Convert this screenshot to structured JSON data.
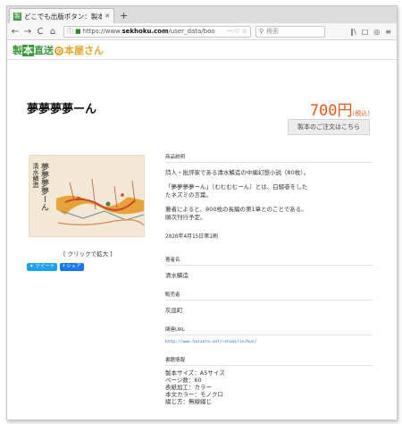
{
  "browser": {
    "tab_title": "どこでも出版ボタン：製本直",
    "tab_close": "✕",
    "new_tab": "+",
    "url_prefix": "https://www.",
    "url_host": "sekhoku.com",
    "url_path": "/user_data/boo",
    "url_more": "···",
    "search_placeholder": "検索"
  },
  "site": {
    "logo_part1": "製",
    "logo_part2": "本",
    "logo_part3": "直送",
    "logo_part4": "",
    "logo_circle": "の",
    "logo_part5": "本屋さん"
  },
  "product": {
    "title": "夢夢夢夢ーん",
    "price": "700円",
    "price_tax": "(税込)",
    "order_button": "製本のご注文はこちら",
    "cover_title": "夢夢夢夢ーん",
    "cover_author": "清水鱗造",
    "enlarge_label": "[ クリックで拡大 ]",
    "tweet_label": "ツイート",
    "share_label": "シェア"
  },
  "details": {
    "description_label": "商品説明",
    "description": [
      "詩人・批評家である清水鱗造の中編幻想小説（80枚）。",
      "「夢夢夢夢ーん」（むむむむーん）とは、白鯨巻をした\nたネズミの言葉。",
      "著者によると、800枚の長編の第1章とのことである。\n順次刊行予定。"
    ],
    "published": "2020年4月15日第1刷",
    "author_label": "著者名",
    "author": "清水鱗造",
    "publisher_label": "販売者",
    "publisher": "灰皿町",
    "related_label": "関連URL",
    "related_url": "http://www.haizara.net/~shimirin/bus/",
    "book_info_label": "書籍情報",
    "book_info": [
      "製本サイズ：A5サイズ",
      "ページ数：60",
      "表紙加工：カラー",
      "本文カラー：モノクロ",
      "綴じ方：無線綴じ"
    ]
  }
}
